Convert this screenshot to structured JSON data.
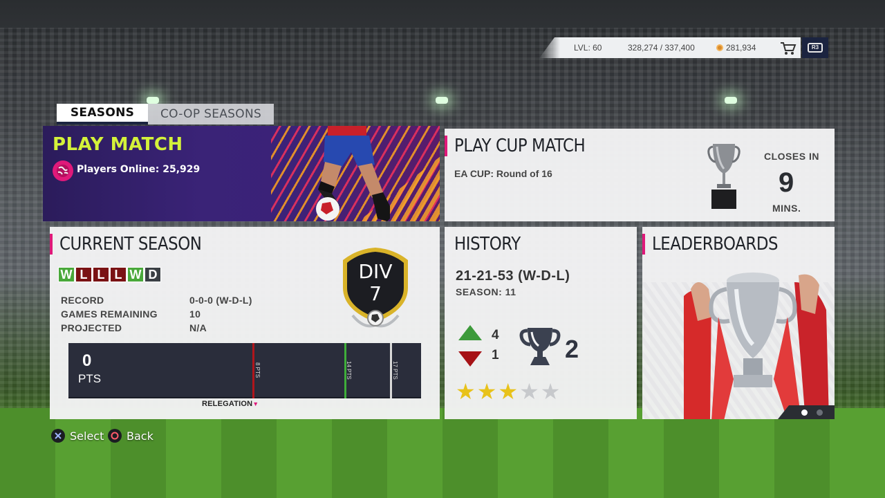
{
  "status": {
    "level": "LVL: 60",
    "xp": "328,274 / 337,400",
    "coins": "281,934",
    "r3_label": "R3"
  },
  "tabs": [
    {
      "label": "SEASONS",
      "active": true
    },
    {
      "label": "CO-OP SEASONS",
      "active": false
    }
  ],
  "play_match": {
    "title": "PLAY MATCH",
    "players_online": "Players Online: 25,929"
  },
  "cup": {
    "title": "PLAY CUP MATCH",
    "subtitle": "EA CUP: Round of 16",
    "closes_label": "CLOSES IN",
    "closes_value": "9",
    "closes_unit": "MINS."
  },
  "current_season": {
    "title": "CURRENT SEASON",
    "form": [
      "W",
      "L",
      "L",
      "L",
      "W",
      "D"
    ],
    "stats": [
      {
        "label": "RECORD",
        "value": "0-0-0 (W-D-L)"
      },
      {
        "label": "GAMES REMAINING",
        "value": "10"
      },
      {
        "label": "PROJECTED",
        "value": "N/A"
      }
    ],
    "division_label": "DIV",
    "division_number": "7",
    "points": "0",
    "points_label": "PTS",
    "markers": [
      {
        "label": "8 PTS",
        "color": "#b0151b"
      },
      {
        "label": "14 PTS",
        "color": "#3fae3a"
      },
      {
        "label": "17 PTS",
        "color": "#d9d9d9"
      }
    ],
    "relegation_label": "RELEGATION"
  },
  "history": {
    "title": "HISTORY",
    "record": "21-21-53 (W-D-L)",
    "season": "SEASON: 11",
    "promotions": "4",
    "relegations": "1",
    "titles": "2",
    "stars_filled": 3,
    "stars_total": 5
  },
  "leaderboards": {
    "title": "LEADERBOARDS",
    "page": 1,
    "pages": 2
  },
  "hints": [
    {
      "label": "Select",
      "icon": "cross-button-icon"
    },
    {
      "label": "Back",
      "icon": "circle-button-icon"
    }
  ],
  "colors": {
    "accent": "#e0197a",
    "play_title": "#d4f23a",
    "win": "#49a83a",
    "loss": "#7a1214",
    "draw": "#3a3f44"
  }
}
